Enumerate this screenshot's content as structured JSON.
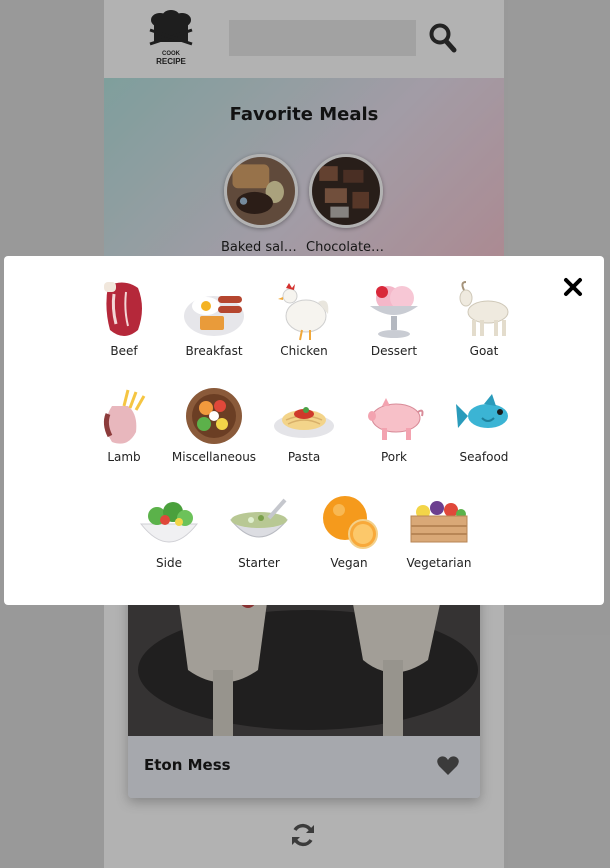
{
  "header": {
    "logo_text_top": "COOK",
    "logo_text_bottom": "RECIPE",
    "search_placeholder": "",
    "search_icon": "search-icon"
  },
  "favorites": {
    "title": "Favorite Meals",
    "items": [
      {
        "name": "Baked salmon"
      },
      {
        "name": "Chocolate Gateau"
      }
    ]
  },
  "random_meal": {
    "name": "Eton Mess",
    "favorite_icon": "heart-icon",
    "refresh_icon": "refresh-icon"
  },
  "categories_modal": {
    "close_icon": "close-icon",
    "categories": [
      {
        "label": "Beef",
        "icon": "beef-icon"
      },
      {
        "label": "Breakfast",
        "icon": "breakfast-icon"
      },
      {
        "label": "Chicken",
        "icon": "chicken-icon"
      },
      {
        "label": "Dessert",
        "icon": "dessert-icon"
      },
      {
        "label": "Goat",
        "icon": "goat-icon"
      },
      {
        "label": "Lamb",
        "icon": "lamb-icon"
      },
      {
        "label": "Miscellaneous",
        "icon": "miscellaneous-icon"
      },
      {
        "label": "Pasta",
        "icon": "pasta-icon"
      },
      {
        "label": "Pork",
        "icon": "pork-icon"
      },
      {
        "label": "Seafood",
        "icon": "seafood-icon"
      },
      {
        "label": "Side",
        "icon": "side-icon"
      },
      {
        "label": "Starter",
        "icon": "starter-icon"
      },
      {
        "label": "Vegan",
        "icon": "vegan-icon"
      },
      {
        "label": "Vegetarian",
        "icon": "vegetarian-icon"
      }
    ]
  }
}
